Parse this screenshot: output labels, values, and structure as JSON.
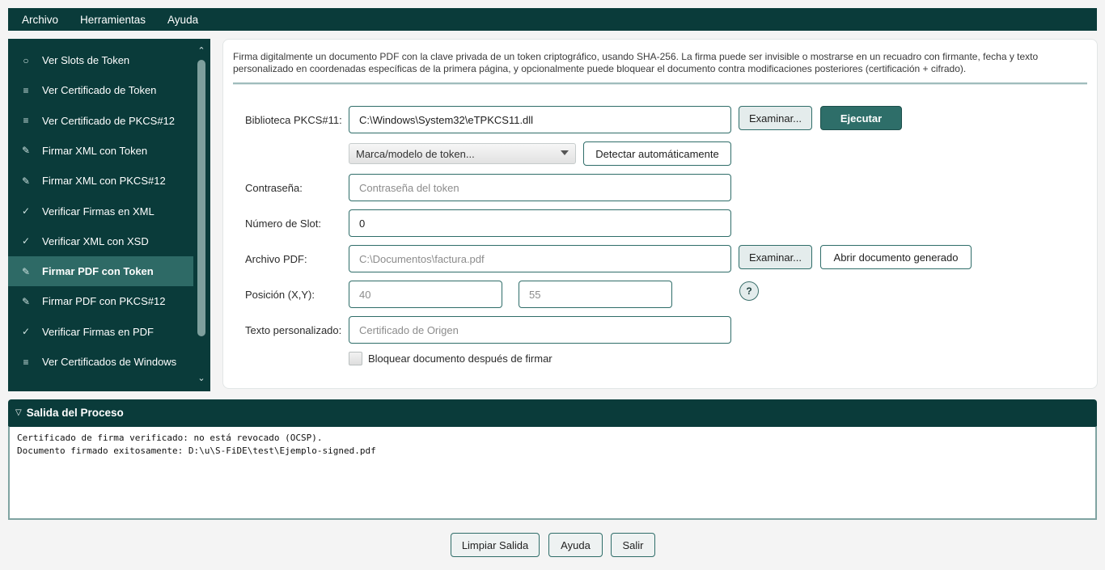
{
  "menu": [
    "Archivo",
    "Herramientas",
    "Ayuda"
  ],
  "sidebar": {
    "items": [
      {
        "icon": "○",
        "icon_name": "circle-icon",
        "label": "Ver Slots de Token"
      },
      {
        "icon": "≡",
        "icon_name": "list-icon",
        "label": "Ver Certificado de Token"
      },
      {
        "icon": "≡",
        "icon_name": "list-icon",
        "label": "Ver Certificado de PKCS#12"
      },
      {
        "icon": "✎",
        "icon_name": "sign-icon",
        "label": "Firmar XML con Token"
      },
      {
        "icon": "✎",
        "icon_name": "sign-icon",
        "label": "Firmar XML con PKCS#12"
      },
      {
        "icon": "✓",
        "icon_name": "check-icon",
        "label": "Verificar Firmas en XML"
      },
      {
        "icon": "✓",
        "icon_name": "check-icon",
        "label": "Verificar XML con XSD"
      },
      {
        "icon": "✎",
        "icon_name": "sign-icon",
        "label": "Firmar PDF con Token",
        "active": true
      },
      {
        "icon": "✎",
        "icon_name": "sign-icon",
        "label": "Firmar PDF con PKCS#12"
      },
      {
        "icon": "✓",
        "icon_name": "check-icon",
        "label": "Verificar Firmas en PDF"
      },
      {
        "icon": "≡",
        "icon_name": "list-icon",
        "label": "Ver Certificados de Windows"
      }
    ],
    "scroll_up": "⌃",
    "scroll_down": "⌄"
  },
  "main": {
    "description": "Firma digitalmente un documento PDF con la clave privada de un token criptográfico, usando SHA-256. La firma puede ser invisible o mostrarse en un recuadro con firmante, fecha y texto personalizado en coordenadas específicas de la primera página, y opcionalmente puede bloquear el documento contra modificaciones posteriores (certificación + cifrado).",
    "pkcs11": {
      "label": "Biblioteca PKCS#11:",
      "value": "C:\\Windows\\System32\\eTPKCS11.dll",
      "browse": "Examinar...",
      "run": "Ejecutar"
    },
    "token_model": {
      "selected": "Marca/modelo de token...",
      "detect": "Detectar automáticamente"
    },
    "password": {
      "label": "Contraseña:",
      "placeholder": "Contraseña del token"
    },
    "slot": {
      "label": "Número de Slot:",
      "value": "0"
    },
    "pdf": {
      "label": "Archivo PDF:",
      "placeholder": "C:\\Documentos\\factura.pdf",
      "browse": "Examinar...",
      "open": "Abrir documento generado"
    },
    "position": {
      "label": "Posición (X,Y):",
      "x_placeholder": "40",
      "y_placeholder": "55",
      "help": "?"
    },
    "custom_text": {
      "label": "Texto personalizado:",
      "placeholder": "Certificado de Origen"
    },
    "lock": {
      "label": "Bloquear documento después de firmar"
    }
  },
  "output": {
    "title": "Salida del Proceso",
    "lines": [
      "Certificado de firma verificado: no está revocado (OCSP).",
      "Documento firmado exitosamente: D:\\u\\S-FiDE\\test\\Ejemplo-signed.pdf"
    ]
  },
  "footer": {
    "clear": "Limpiar Salida",
    "help": "Ayuda",
    "exit": "Salir"
  }
}
